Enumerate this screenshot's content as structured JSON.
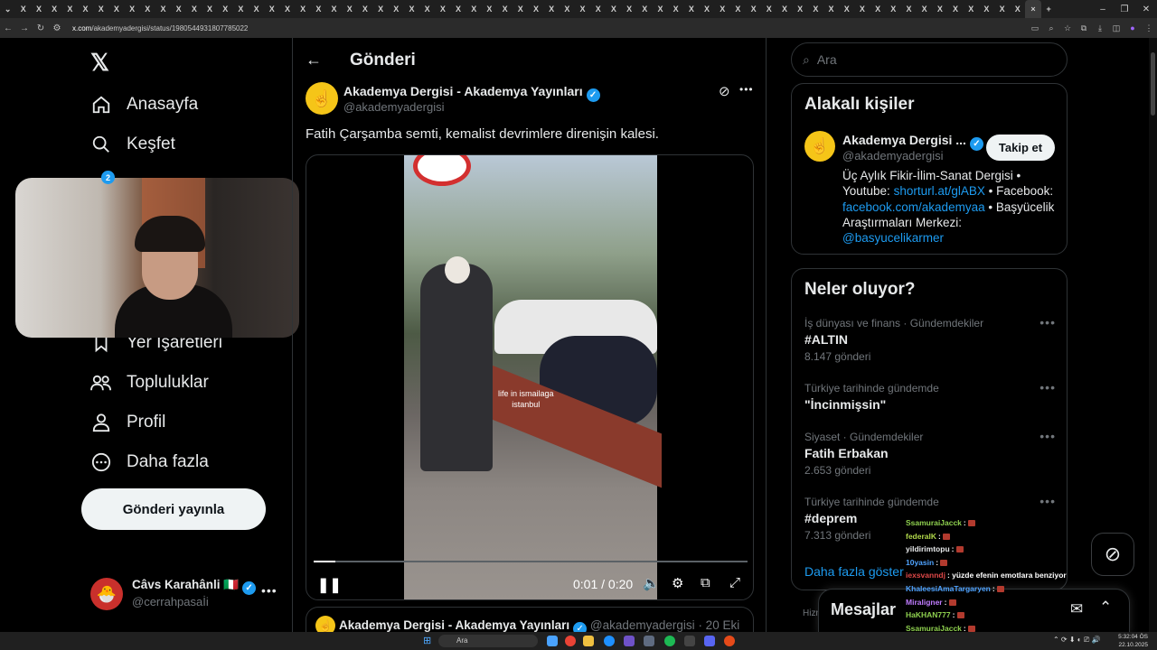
{
  "browser": {
    "tab_label": "X",
    "active_tab_close": "×",
    "new_tab": "+",
    "url_host": "x.com",
    "url_path": "/akademyadergisi/status/1980544931807785022"
  },
  "sidebar": {
    "items": [
      {
        "label": "Anasayfa",
        "icon": "home-icon"
      },
      {
        "label": "Keşfet",
        "icon": "search-icon"
      },
      {
        "label": "Yer İşaretleri",
        "icon": "bookmark-icon"
      },
      {
        "label": "Topluluklar",
        "icon": "people-icon"
      },
      {
        "label": "Profil",
        "icon": "person-icon"
      },
      {
        "label": "Daha fazla",
        "icon": "more-circle-icon"
      }
    ],
    "notification_badge": "2",
    "post_button": "Gönderi yayınla",
    "account": {
      "name": "Câvs Karahânli 🇮🇹",
      "handle": "@cerrahpasaİi"
    }
  },
  "main": {
    "title": "Gönderi",
    "tweet": {
      "author_name": "Akademya Dergisi - Akademya Yayınları",
      "author_handle": "@akademyadergisi",
      "text": "Fatih Çarşamba semti, kemalist devrimlere direnişin kalesi.",
      "video": {
        "caption_line1": "life in ismailaga",
        "caption_line2": "istanbul",
        "time": "0:01 / 0:20",
        "progress": 0.05
      }
    },
    "quoted": {
      "author_name": "Akademya Dergisi - Akademya Yayınları",
      "author_handle": "@akademyadergisi",
      "date": "· 20 Eki"
    }
  },
  "right": {
    "search_placeholder": "Ara",
    "relevant": {
      "title": "Alakalı kişiler",
      "name": "Akademya Dergisi ...",
      "handle": "@akademyadergisi",
      "follow": "Takip et",
      "bio_1": "Üç Aylık Fikir-İlim-Sanat Dergisi • Youtube: ",
      "bio_link1": "shorturl.at/glABX",
      "bio_2": " • Facebook: ",
      "bio_link2": "facebook.com/akademyaa",
      "bio_3": " • Başyücelik Araştırmaları Merkezi: ",
      "bio_link3": "@basyucelikarmer"
    },
    "trends": {
      "title": "Neler oluyor?",
      "items": [
        {
          "meta": "İş dünyası ve finans · Gündemdekiler",
          "name": "#ALTIN",
          "count": "8.147 gönderi"
        },
        {
          "meta": "Türkiye tarihinde gündemde",
          "name": "\"İncinmişsin\"",
          "count": ""
        },
        {
          "meta": "Siyaset · Gündemdekiler",
          "name": "Fatih Erbakan",
          "count": "2.653 gönderi"
        },
        {
          "meta": "Türkiye tarihinde gündemde",
          "name": "#deprem",
          "count": "7.313 gönderi"
        }
      ],
      "show_more": "Daha fazla göster"
    },
    "messages": {
      "title": "Mesajlar",
      "footer_hint": "Hizm"
    }
  },
  "chat": [
    {
      "user": "SsamuraiJacck",
      "color": "#8fd14f",
      "text": ""
    },
    {
      "user": "federalK",
      "color": "#b0d84a",
      "text": ""
    },
    {
      "user": "yildirimtopu",
      "color": "#e7e9ea",
      "text": ""
    },
    {
      "user": "10yasin",
      "color": "#4fa3ff",
      "text": ""
    },
    {
      "user": "iexsvanndj",
      "color": "#e04848",
      "text": "yüzde efenin emotlara benziyor"
    },
    {
      "user": "KhaleesiAmaTargaryen",
      "color": "#4fa3ff",
      "text": ""
    },
    {
      "user": "Miraligner",
      "color": "#c07cff",
      "text": ""
    },
    {
      "user": "HaKHAN777",
      "color": "#8fd14f",
      "text": ""
    },
    {
      "user": "SsamuraiJacck",
      "color": "#8fd14f",
      "text": ""
    }
  ],
  "taskbar": {
    "search": "Ara",
    "time": "5:32:04 ÖS",
    "date": "22.10.2025"
  },
  "colors": {
    "accent": "#1d9bf0",
    "background": "#000000",
    "border": "#2f3336",
    "muted": "#71767b"
  }
}
